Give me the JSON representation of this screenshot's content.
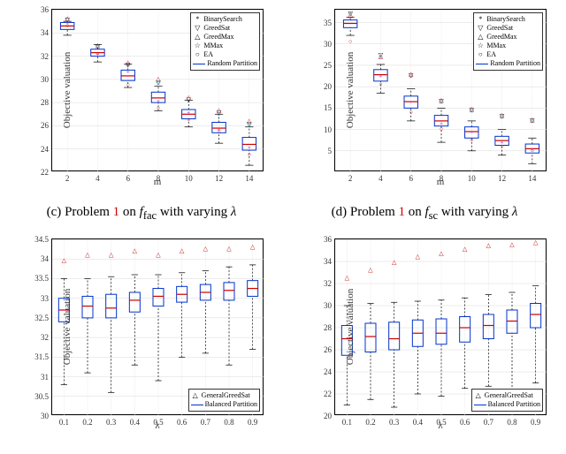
{
  "captions": {
    "a": "Problem 1 on f_fac with varying λ",
    "b": "Problem 1 on f_sc with varying λ",
    "a_prefix": "(c) ",
    "b_prefix": "(d) "
  },
  "axis": {
    "y": "Objective valuation",
    "x_m": "m",
    "x_lambda": "λ"
  },
  "legend_top": {
    "BinarySearch": "BinarySearch",
    "GreedSat": "GreedSat",
    "GreedMax": "GreedMax",
    "MMax": "MMax",
    "EA": "EA",
    "RandomPartition": "Random Partition"
  },
  "legend_bottom": {
    "GeneralGreedSat": "GeneralGreedSat",
    "BalancedPartition": "Balanced Partition"
  },
  "chart_data": [
    {
      "id": "top-left",
      "type": "box+scatter",
      "xlabel": "m",
      "ylabel": "Objective valuation",
      "ylim": [
        22,
        36
      ],
      "xvals": [
        2,
        4,
        6,
        8,
        10,
        12,
        14
      ],
      "box_series": "Random Partition",
      "boxes": [
        {
          "x": 2,
          "min": 33.8,
          "q1": 34.3,
          "med": 34.6,
          "q3": 34.9,
          "max": 35.0
        },
        {
          "x": 4,
          "min": 31.5,
          "q1": 32.0,
          "med": 32.3,
          "q3": 32.6,
          "max": 33.0
        },
        {
          "x": 6,
          "min": 29.3,
          "q1": 29.9,
          "med": 30.3,
          "q3": 30.8,
          "max": 31.3
        },
        {
          "x": 8,
          "min": 27.3,
          "q1": 28.0,
          "med": 28.4,
          "q3": 28.9,
          "max": 29.4
        },
        {
          "x": 10,
          "min": 25.9,
          "q1": 26.6,
          "med": 27.0,
          "q3": 27.4,
          "max": 28.2
        },
        {
          "x": 12,
          "min": 24.5,
          "q1": 25.4,
          "med": 25.8,
          "q3": 26.3,
          "max": 27.0
        },
        {
          "x": 14,
          "min": 22.6,
          "q1": 23.9,
          "med": 24.4,
          "q3": 25.0,
          "max": 25.9
        }
      ],
      "scatter_series": [
        {
          "name": "BinarySearch",
          "sym": "*",
          "cls": "m-bs",
          "pts": [
            [
              2,
              34.7
            ],
            [
              4,
              32.0
            ],
            [
              6,
              30.5
            ],
            [
              8,
              28.0
            ],
            [
              10,
              27.0
            ],
            [
              12,
              25.5
            ],
            [
              14,
              24.0
            ]
          ]
        },
        {
          "name": "GreedSat",
          "sym": "▽",
          "cls": "m-gs",
          "pts": [
            [
              2,
              35.1
            ],
            [
              4,
              32.8
            ],
            [
              6,
              31.2
            ],
            [
              8,
              29.7
            ],
            [
              10,
              28.2
            ],
            [
              12,
              27.1
            ],
            [
              14,
              26.1
            ]
          ]
        },
        {
          "name": "GreedMax",
          "sym": "△",
          "cls": "m-gm",
          "pts": [
            [
              2,
              35.2
            ],
            [
              4,
              32.9
            ],
            [
              6,
              31.4
            ],
            [
              8,
              30.0
            ],
            [
              10,
              28.4
            ],
            [
              12,
              27.3
            ],
            [
              14,
              26.4
            ]
          ]
        },
        {
          "name": "MMax",
          "sym": "☆",
          "cls": "m-mm",
          "pts": [
            [
              2,
              35.1
            ],
            [
              4,
              32.8
            ],
            [
              6,
              31.2
            ],
            [
              8,
              29.6
            ],
            [
              10,
              28.1
            ],
            [
              12,
              27.0
            ],
            [
              14,
              26.0
            ]
          ]
        },
        {
          "name": "EA",
          "sym": "○",
          "cls": "m-ea",
          "pts": [
            [
              2,
              34.6
            ],
            [
              4,
              32.2
            ],
            [
              6,
              29.5
            ],
            [
              8,
              27.5
            ],
            [
              10,
              26.5
            ],
            [
              12,
              25.5
            ],
            [
              14,
              23.5
            ]
          ]
        }
      ]
    },
    {
      "id": "top-right",
      "type": "box+scatter",
      "xlabel": "m",
      "ylabel": "Objective valuation",
      "ylim": [
        0,
        38
      ],
      "yticks": [
        5,
        10,
        15,
        20,
        25,
        30,
        35
      ],
      "xvals": [
        2,
        4,
        6,
        8,
        10,
        12,
        14
      ],
      "box_series": "Random Partition",
      "boxes": [
        {
          "x": 2,
          "min": 32.0,
          "q1": 33.8,
          "med": 34.8,
          "q3": 35.6,
          "max": 36.2
        },
        {
          "x": 4,
          "min": 18.5,
          "q1": 21.3,
          "med": 22.8,
          "q3": 24.0,
          "max": 25.2
        },
        {
          "x": 6,
          "min": 12.0,
          "q1": 15.0,
          "med": 16.5,
          "q3": 17.8,
          "max": 19.5
        },
        {
          "x": 8,
          "min": 7.0,
          "q1": 10.8,
          "med": 12.0,
          "q3": 13.3,
          "max": 15.0
        },
        {
          "x": 10,
          "min": 5.0,
          "q1": 8.0,
          "med": 9.5,
          "q3": 10.6,
          "max": 12.0
        },
        {
          "x": 12,
          "min": 4.0,
          "q1": 6.3,
          "med": 7.4,
          "q3": 8.4,
          "max": 10.0
        },
        {
          "x": 14,
          "min": 2.0,
          "q1": 4.5,
          "med": 5.5,
          "q3": 6.6,
          "max": 8.0
        }
      ],
      "scatter_series": [
        {
          "name": "BinarySearch",
          "sym": "*",
          "cls": "m-bs",
          "pts": [
            [
              2,
              35.8
            ],
            [
              4,
              22.0
            ],
            [
              6,
              16.0
            ],
            [
              8,
              11.0
            ],
            [
              10,
              9.0
            ],
            [
              12,
              6.5
            ],
            [
              14,
              5.0
            ]
          ]
        },
        {
          "name": "GreedSat",
          "sym": "▽",
          "cls": "m-gs",
          "pts": [
            [
              2,
              37.0
            ],
            [
              4,
              27.3
            ],
            [
              6,
              22.5
            ],
            [
              8,
              16.5
            ],
            [
              10,
              14.5
            ],
            [
              12,
              13.0
            ],
            [
              14,
              12.0
            ]
          ]
        },
        {
          "name": "GreedMax",
          "sym": "△",
          "cls": "m-gm",
          "pts": [
            [
              2,
              36.8
            ],
            [
              4,
              27.0
            ],
            [
              6,
              22.8
            ],
            [
              8,
              16.8
            ],
            [
              10,
              14.7
            ],
            [
              12,
              13.2
            ],
            [
              14,
              12.2
            ]
          ]
        },
        {
          "name": "MMax",
          "sym": "☆",
          "cls": "m-mm",
          "pts": [
            [
              2,
              36.9
            ],
            [
              4,
              26.8
            ],
            [
              6,
              22.3
            ],
            [
              8,
              16.3
            ],
            [
              10,
              14.3
            ],
            [
              12,
              12.8
            ],
            [
              14,
              11.8
            ]
          ]
        },
        {
          "name": "EA",
          "sym": "○",
          "cls": "m-ea",
          "pts": [
            [
              2,
              30.5
            ],
            [
              4,
              20.5
            ],
            [
              6,
              14.0
            ],
            [
              8,
              10.0
            ],
            [
              10,
              7.5
            ],
            [
              12,
              6.0
            ],
            [
              14,
              5.0
            ]
          ]
        }
      ]
    },
    {
      "id": "bottom-left",
      "type": "box+scatter",
      "xlabel": "λ",
      "ylabel": "Objective valuation",
      "ylim": [
        30,
        34.5
      ],
      "yticks": [
        30,
        30.5,
        31,
        31.5,
        32,
        32.5,
        33,
        33.5,
        34,
        34.5
      ],
      "xvals": [
        0.1,
        0.2,
        0.3,
        0.4,
        0.5,
        0.6,
        0.7,
        0.8,
        0.9
      ],
      "box_series": "Balanced Partition",
      "boxes": [
        {
          "x": 0.1,
          "min": 30.8,
          "q1": 32.4,
          "med": 32.7,
          "q3": 33.0,
          "max": 33.5
        },
        {
          "x": 0.2,
          "min": 31.1,
          "q1": 32.5,
          "med": 32.8,
          "q3": 33.05,
          "max": 33.5
        },
        {
          "x": 0.3,
          "min": 30.6,
          "q1": 32.5,
          "med": 32.75,
          "q3": 33.1,
          "max": 33.55
        },
        {
          "x": 0.4,
          "min": 31.3,
          "q1": 32.65,
          "med": 32.95,
          "q3": 33.15,
          "max": 33.6
        },
        {
          "x": 0.5,
          "min": 30.9,
          "q1": 32.8,
          "med": 33.05,
          "q3": 33.25,
          "max": 33.6
        },
        {
          "x": 0.6,
          "min": 31.5,
          "q1": 32.9,
          "med": 33.1,
          "q3": 33.3,
          "max": 33.65
        },
        {
          "x": 0.7,
          "min": 31.6,
          "q1": 32.95,
          "med": 33.15,
          "q3": 33.35,
          "max": 33.7
        },
        {
          "x": 0.8,
          "min": 31.3,
          "q1": 32.95,
          "med": 33.2,
          "q3": 33.4,
          "max": 33.8
        },
        {
          "x": 0.9,
          "min": 31.7,
          "q1": 33.05,
          "med": 33.25,
          "q3": 33.45,
          "max": 33.85
        }
      ],
      "scatter_series": [
        {
          "name": "GeneralGreedSat",
          "sym": "△",
          "cls": "m-ggs",
          "pts": [
            [
              0.1,
              33.95
            ],
            [
              0.2,
              34.1
            ],
            [
              0.3,
              34.1
            ],
            [
              0.4,
              34.2
            ],
            [
              0.5,
              34.1
            ],
            [
              0.6,
              34.2
            ],
            [
              0.7,
              34.25
            ],
            [
              0.8,
              34.25
            ],
            [
              0.9,
              34.3
            ]
          ]
        }
      ]
    },
    {
      "id": "bottom-right",
      "type": "box+scatter",
      "xlabel": "λ",
      "ylabel": "Objective valuation",
      "ylim": [
        20,
        36
      ],
      "yticks": [
        20,
        22,
        24,
        26,
        28,
        30,
        32,
        34,
        36
      ],
      "xvals": [
        0.1,
        0.2,
        0.3,
        0.4,
        0.5,
        0.6,
        0.7,
        0.8,
        0.9
      ],
      "box_series": "Balanced Partition",
      "boxes": [
        {
          "x": 0.1,
          "min": 21.0,
          "q1": 25.5,
          "med": 27.0,
          "q3": 28.2,
          "max": 30.0
        },
        {
          "x": 0.2,
          "min": 21.5,
          "q1": 25.8,
          "med": 27.2,
          "q3": 28.4,
          "max": 30.2
        },
        {
          "x": 0.3,
          "min": 20.8,
          "q1": 26.0,
          "med": 27.0,
          "q3": 28.5,
          "max": 30.3
        },
        {
          "x": 0.4,
          "min": 22.0,
          "q1": 26.3,
          "med": 27.5,
          "q3": 28.7,
          "max": 30.4
        },
        {
          "x": 0.5,
          "min": 21.8,
          "q1": 26.5,
          "med": 27.5,
          "q3": 28.8,
          "max": 30.5
        },
        {
          "x": 0.6,
          "min": 22.5,
          "q1": 26.7,
          "med": 28.0,
          "q3": 29.0,
          "max": 30.7
        },
        {
          "x": 0.7,
          "min": 22.7,
          "q1": 27.0,
          "med": 28.2,
          "q3": 29.2,
          "max": 31.0
        },
        {
          "x": 0.8,
          "min": 22.0,
          "q1": 27.5,
          "med": 28.6,
          "q3": 29.6,
          "max": 31.2
        },
        {
          "x": 0.9,
          "min": 23.0,
          "q1": 28.0,
          "med": 29.2,
          "q3": 30.2,
          "max": 31.8
        }
      ],
      "scatter_series": [
        {
          "name": "GeneralGreedSat",
          "sym": "△",
          "cls": "m-ggs",
          "pts": [
            [
              0.1,
              32.5
            ],
            [
              0.2,
              33.2
            ],
            [
              0.3,
              33.9
            ],
            [
              0.4,
              34.4
            ],
            [
              0.5,
              34.7
            ],
            [
              0.6,
              35.1
            ],
            [
              0.7,
              35.4
            ],
            [
              0.8,
              35.5
            ],
            [
              0.9,
              35.7
            ]
          ]
        }
      ]
    }
  ]
}
